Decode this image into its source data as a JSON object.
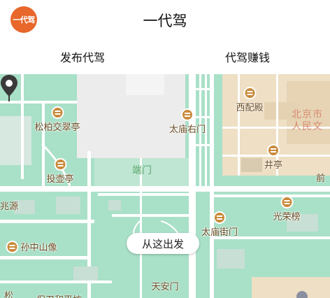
{
  "header": {
    "logo_text": "一代驾",
    "title": "一代驾"
  },
  "tabs": [
    {
      "label": "发布代驾"
    },
    {
      "label": "代驾赚钱"
    }
  ],
  "map": {
    "pois": [
      "西配殿",
      "松柏交翠亭",
      "太庙右门",
      "井亭",
      "投壶亭",
      "光荣榜",
      "太庙街门",
      "孙中山像"
    ],
    "area_label": "端门",
    "district_label_line1": "北京市",
    "district_label_line2": "人民文",
    "edge_labels": [
      "前",
      "兆源",
      "松",
      "保卫和平坊"
    ],
    "start_bubble": "从这出发",
    "pin_label": "天安门",
    "colors": {
      "park_green": "#a9e0c8",
      "road": "#ffffff",
      "district_beige": "#eedfc5",
      "poi_brown": "#c98a3a",
      "accent_orange": "#e8672b"
    }
  }
}
